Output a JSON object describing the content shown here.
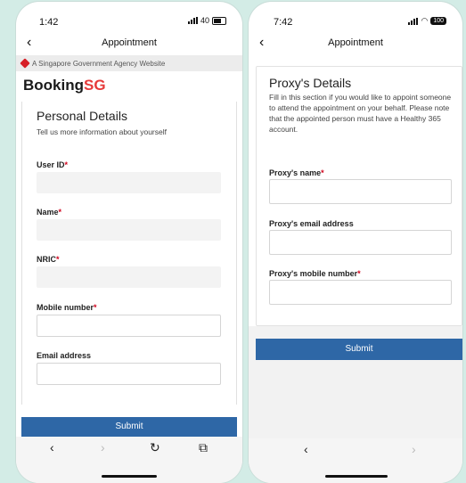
{
  "left": {
    "status": {
      "time": "1:42",
      "network": "40"
    },
    "appbar": {
      "title": "Appointment"
    },
    "gov_banner": "A Singapore Government Agency Website",
    "brand": {
      "part1": "Booking",
      "part2": "SG"
    },
    "section": {
      "title": "Personal Details",
      "subtitle": "Tell us more information about yourself"
    },
    "fields": {
      "user_id": "User ID",
      "name": "Name",
      "nric": "NRIC",
      "mobile": "Mobile number",
      "email": "Email address"
    },
    "submit_label": "Submit",
    "nav": {
      "back": "‹",
      "forward": "›",
      "reload": "↻",
      "share": "⧉"
    }
  },
  "right": {
    "status": {
      "time": "7:42",
      "battery": "100"
    },
    "appbar": {
      "title": "Appointment"
    },
    "section": {
      "title": "Proxy's Details",
      "subtitle": "Fill in this section if you would like to appoint someone to attend the appointment on your behalf. Please note that the appointed person must have a Healthy 365 account."
    },
    "fields": {
      "proxy_name": "Proxy's name",
      "proxy_email": "Proxy's email address",
      "proxy_mobile": "Proxy's mobile number"
    },
    "submit_label": "Submit",
    "nav": {
      "back": "‹",
      "forward": "›"
    }
  },
  "required_marker": "*",
  "colors": {
    "brand_red": "#e63a3a",
    "button_blue": "#2e67a6",
    "required": "#d0021b"
  }
}
